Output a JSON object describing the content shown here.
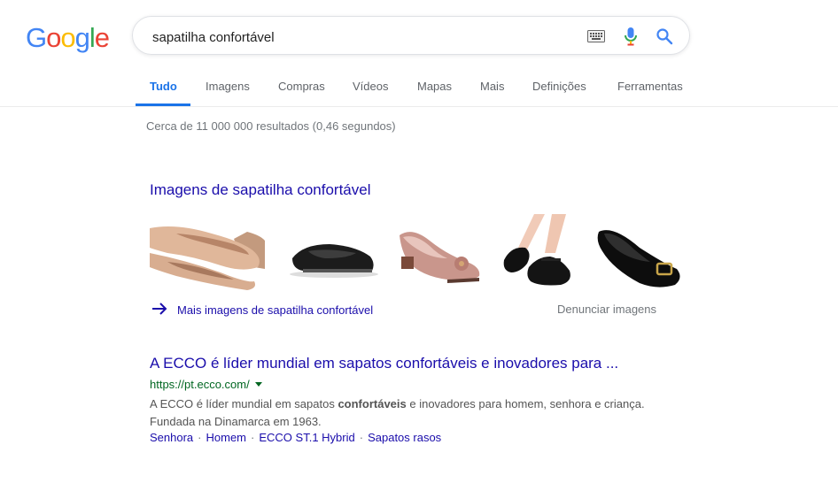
{
  "logo": {
    "letters": [
      "G",
      "o",
      "o",
      "g",
      "l",
      "e"
    ],
    "colors": [
      "#4285f4",
      "#ea4335",
      "#fbbc05",
      "#4285f4",
      "#34a853",
      "#ea4335"
    ]
  },
  "search": {
    "query": "sapatilha confortável",
    "icons": [
      "keyboard-icon",
      "microphone-icon",
      "search-icon"
    ]
  },
  "tabs": [
    {
      "label": "Tudo",
      "active": true
    },
    {
      "label": "Imagens"
    },
    {
      "label": "Compras"
    },
    {
      "label": "Vídeos"
    },
    {
      "label": "Mapas"
    },
    {
      "label": "Mais"
    },
    {
      "label": "Definições"
    },
    {
      "label": "Ferramentas"
    }
  ],
  "result_stats": "Cerca de 11 000 000 resultados (0,46 segundos)",
  "images_block": {
    "title": "Imagens de sapatilha confortável",
    "thumbnails": [
      "nude-flat-shoes",
      "black-flat-shoe",
      "pink-heel-shoe-with-bow",
      "black-mary-jane-shoes-on-feet",
      "black-flat-shoe-with-buckle"
    ],
    "more_label": "Mais imagens de sapatilha confortável",
    "report_label": "Denunciar imagens"
  },
  "result": {
    "title": "A ECCO é líder mundial em sapatos confortáveis e inovadores para ...",
    "url": "https://pt.ecco.com/",
    "snippet_before": "A ECCO é líder mundial em sapatos ",
    "snippet_bold": "confortáveis",
    "snippet_after": " e inovadores para homem, senhora e criança. Fundada na Dinamarca em 1963.",
    "sitelinks": [
      "Senhora",
      "Homem",
      "ECCO ST.1 Hybrid",
      "Sapatos rasos"
    ]
  },
  "colors": {
    "link": "#1a0dab",
    "url_green": "#006621",
    "tab_active": "#1a73e8"
  }
}
